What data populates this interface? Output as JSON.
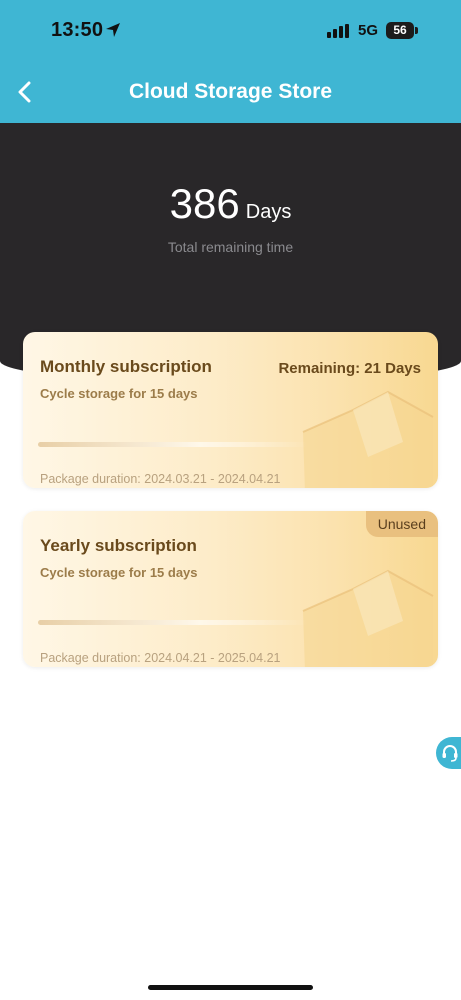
{
  "status_bar": {
    "time": "13:50",
    "network": "5G",
    "battery": "56"
  },
  "nav": {
    "title": "Cloud Storage Store"
  },
  "summary": {
    "value": "386",
    "unit": "Days",
    "label": "Total remaining time"
  },
  "subscriptions": [
    {
      "title": "Monthly subscription",
      "subtitle": "Cycle storage for 15 days",
      "remaining": "Remaining: 21 Days",
      "duration": "Package duration: 2024.03.21 - 2024.04.21"
    },
    {
      "title": "Yearly subscription",
      "subtitle": "Cycle storage for 15 days",
      "badge": "Unused",
      "duration": "Package duration: 2024.04.21 - 2025.04.21"
    }
  ],
  "colors": {
    "accent": "#3fb6d3",
    "dark_panel": "#292729",
    "card_text": "#6a4a1c",
    "badge_bg": "#e9c07f"
  },
  "icons": {
    "back": "chevron-left-icon",
    "location": "location-arrow-icon",
    "signal": "signal-bars-icon",
    "support": "headset-icon"
  }
}
